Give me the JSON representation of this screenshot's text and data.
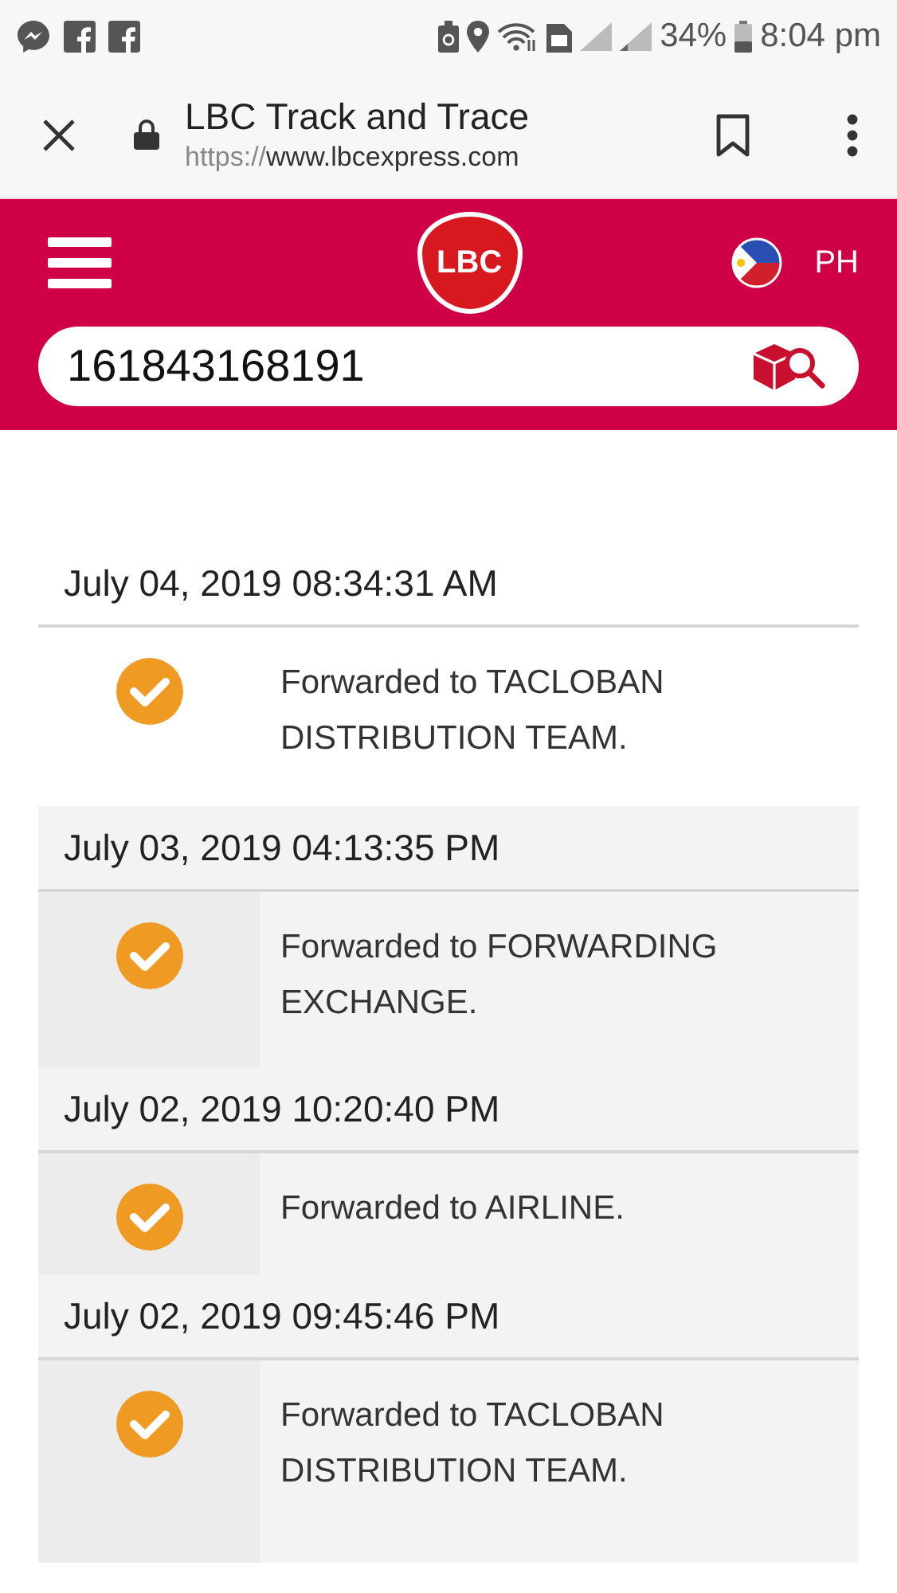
{
  "status_bar": {
    "battery": "34%",
    "time": "8:04 pm"
  },
  "browser": {
    "title": "LBC Track and Trace",
    "url_scheme": "https://",
    "url_host": "www.lbcexpress.com"
  },
  "header": {
    "logo": "LBC",
    "country": "PH"
  },
  "search": {
    "value": "161843168191"
  },
  "events": [
    {
      "date": "July 04, 2019 08:34:31 AM",
      "status": "Forwarded to TACLOBAN DISTRIBUTION TEAM."
    },
    {
      "date": "July 03, 2019 04:13:35 PM",
      "status": "Forwarded to FORWARDING EXCHANGE."
    },
    {
      "date": "July 02, 2019 10:20:40 PM",
      "status": "Forwarded to AIRLINE."
    },
    {
      "date": "July 02, 2019 09:45:46 PM",
      "status": "Forwarded to TACLOBAN DISTRIBUTION TEAM."
    }
  ]
}
